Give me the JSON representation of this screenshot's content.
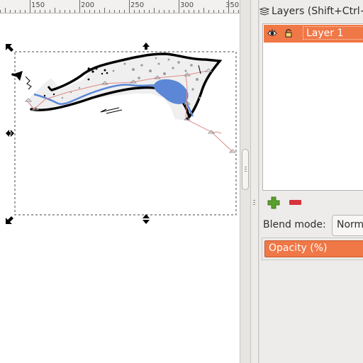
{
  "ruler": {
    "labels": [
      "150",
      "200",
      "250",
      "300",
      "350"
    ]
  },
  "layers_panel": {
    "title": "Layers (Shift+Ctrl+L",
    "layers": [
      {
        "name": "Layer 1",
        "visible": true,
        "locked": false,
        "selected": true
      }
    ],
    "add_icon": "plus-icon",
    "remove_icon": "minus-icon",
    "blend_mode_label": "Blend mode:",
    "blend_mode_value": "Norm",
    "opacity_label": "Opacity (%)"
  },
  "colors": {
    "selection_accent": "#f07746",
    "add_green": "#5aa02c",
    "remove_red": "#d8323b",
    "water_blue": "#5b87d6"
  }
}
